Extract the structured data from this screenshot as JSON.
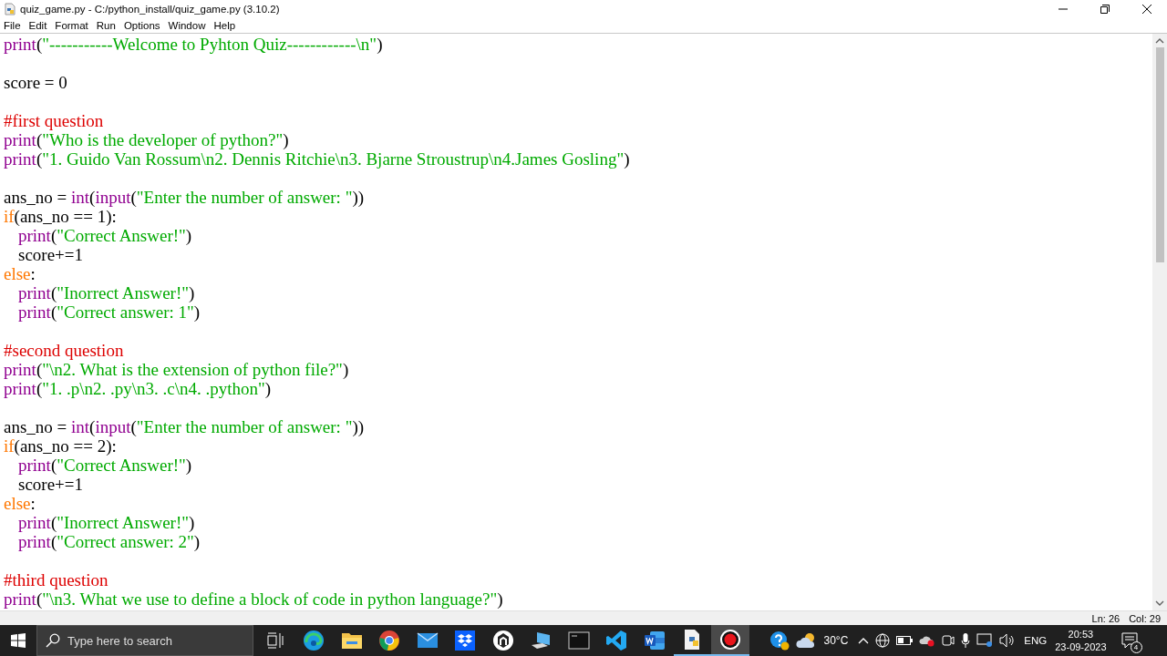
{
  "window": {
    "title": "quiz_game.py - C:/python_install/quiz_game.py (3.10.2)"
  },
  "menu": [
    "File",
    "Edit",
    "Format",
    "Run",
    "Options",
    "Window",
    "Help"
  ],
  "editor": {
    "lines": [
      {
        "kind": "code",
        "tokens": [
          {
            "kind": "builtin",
            "text": "print"
          },
          {
            "kind": "plain",
            "text": "("
          },
          {
            "kind": "string",
            "text": "\"-----------Welcome to Pyhton Quiz------------\\n\""
          },
          {
            "kind": "plain",
            "text": ")"
          }
        ]
      },
      {
        "kind": "blank"
      },
      {
        "kind": "code",
        "tokens": [
          {
            "kind": "plain",
            "text": "score = 0"
          }
        ]
      },
      {
        "kind": "blank"
      },
      {
        "kind": "code",
        "tokens": [
          {
            "kind": "comment",
            "text": "#first question"
          }
        ]
      },
      {
        "kind": "code",
        "tokens": [
          {
            "kind": "builtin",
            "text": "print"
          },
          {
            "kind": "plain",
            "text": "("
          },
          {
            "kind": "string",
            "text": "\"Who is the developer of python?\""
          },
          {
            "kind": "plain",
            "text": ")"
          }
        ]
      },
      {
        "kind": "code",
        "tokens": [
          {
            "kind": "builtin",
            "text": "print"
          },
          {
            "kind": "plain",
            "text": "("
          },
          {
            "kind": "string",
            "text": "\"1. Guido Van Rossum\\n2. Dennis Ritchie\\n3. Bjarne Stroustrup\\n4.James Gosling\""
          },
          {
            "kind": "plain",
            "text": ")"
          }
        ]
      },
      {
        "kind": "blank"
      },
      {
        "kind": "code",
        "tokens": [
          {
            "kind": "plain",
            "text": "ans_no = "
          },
          {
            "kind": "builtin",
            "text": "int"
          },
          {
            "kind": "plain",
            "text": "("
          },
          {
            "kind": "builtin",
            "text": "input"
          },
          {
            "kind": "plain",
            "text": "("
          },
          {
            "kind": "string",
            "text": "\"Enter the number of answer: \""
          },
          {
            "kind": "plain",
            "text": "))"
          }
        ]
      },
      {
        "kind": "code",
        "tokens": [
          {
            "kind": "keyword",
            "text": "if"
          },
          {
            "kind": "plain",
            "text": "(ans_no == 1):"
          }
        ]
      },
      {
        "kind": "indented",
        "tokens": [
          {
            "kind": "builtin",
            "text": "print"
          },
          {
            "kind": "plain",
            "text": "("
          },
          {
            "kind": "string",
            "text": "\"Correct Answer!\""
          },
          {
            "kind": "plain",
            "text": ")"
          }
        ]
      },
      {
        "kind": "indented",
        "tokens": [
          {
            "kind": "plain",
            "text": "score+=1"
          }
        ]
      },
      {
        "kind": "code",
        "tokens": [
          {
            "kind": "keyword",
            "text": "else"
          },
          {
            "kind": "plain",
            "text": ":"
          }
        ]
      },
      {
        "kind": "indented",
        "tokens": [
          {
            "kind": "builtin",
            "text": "print"
          },
          {
            "kind": "plain",
            "text": "("
          },
          {
            "kind": "string",
            "text": "\"Inorrect Answer!\""
          },
          {
            "kind": "plain",
            "text": ")"
          }
        ]
      },
      {
        "kind": "indented",
        "tokens": [
          {
            "kind": "builtin",
            "text": "print"
          },
          {
            "kind": "plain",
            "text": "("
          },
          {
            "kind": "string",
            "text": "\"Correct answer: 1\""
          },
          {
            "kind": "plain",
            "text": ")"
          }
        ]
      },
      {
        "kind": "blank"
      },
      {
        "kind": "code",
        "tokens": [
          {
            "kind": "comment",
            "text": "#second question"
          }
        ]
      },
      {
        "kind": "code",
        "tokens": [
          {
            "kind": "builtin",
            "text": "print"
          },
          {
            "kind": "plain",
            "text": "("
          },
          {
            "kind": "string",
            "text": "\"\\n2. What is the extension of python file?\""
          },
          {
            "kind": "plain",
            "text": ")"
          }
        ]
      },
      {
        "kind": "code",
        "tokens": [
          {
            "kind": "builtin",
            "text": "print"
          },
          {
            "kind": "plain",
            "text": "("
          },
          {
            "kind": "string",
            "text": "\"1. .p\\n2. .py\\n3. .c\\n4. .python\""
          },
          {
            "kind": "plain",
            "text": ")"
          }
        ]
      },
      {
        "kind": "blank"
      },
      {
        "kind": "code",
        "tokens": [
          {
            "kind": "plain",
            "text": "ans_no = "
          },
          {
            "kind": "builtin",
            "text": "int"
          },
          {
            "kind": "plain",
            "text": "("
          },
          {
            "kind": "builtin",
            "text": "input"
          },
          {
            "kind": "plain",
            "text": "("
          },
          {
            "kind": "string",
            "text": "\"Enter the number of answer: \""
          },
          {
            "kind": "plain",
            "text": "))"
          }
        ]
      },
      {
        "kind": "code",
        "tokens": [
          {
            "kind": "keyword",
            "text": "if"
          },
          {
            "kind": "plain",
            "text": "(ans_no == 2):"
          }
        ]
      },
      {
        "kind": "indented",
        "tokens": [
          {
            "kind": "builtin",
            "text": "print"
          },
          {
            "kind": "plain",
            "text": "("
          },
          {
            "kind": "string",
            "text": "\"Correct Answer!\""
          },
          {
            "kind": "plain",
            "text": ")"
          }
        ]
      },
      {
        "kind": "indented",
        "tokens": [
          {
            "kind": "plain",
            "text": "score+=1"
          }
        ]
      },
      {
        "kind": "code",
        "tokens": [
          {
            "kind": "keyword",
            "text": "else"
          },
          {
            "kind": "plain",
            "text": ":"
          }
        ]
      },
      {
        "kind": "indented",
        "tokens": [
          {
            "kind": "builtin",
            "text": "print"
          },
          {
            "kind": "plain",
            "text": "("
          },
          {
            "kind": "string",
            "text": "\"Inorrect Answer!\""
          },
          {
            "kind": "plain",
            "text": ")"
          }
        ]
      },
      {
        "kind": "indented",
        "tokens": [
          {
            "kind": "builtin",
            "text": "print"
          },
          {
            "kind": "plain",
            "text": "("
          },
          {
            "kind": "string",
            "text": "\"Correct answer: 2\""
          },
          {
            "kind": "plain",
            "text": ")"
          }
        ]
      },
      {
        "kind": "blank"
      },
      {
        "kind": "code",
        "tokens": [
          {
            "kind": "comment",
            "text": "#third question"
          }
        ]
      },
      {
        "kind": "code",
        "tokens": [
          {
            "kind": "builtin",
            "text": "print"
          },
          {
            "kind": "plain",
            "text": "("
          },
          {
            "kind": "string",
            "text": "\"\\n3. What we use to define a block of code in python language?\""
          },
          {
            "kind": "plain",
            "text": ")"
          }
        ]
      }
    ]
  },
  "status_bar": {
    "line": "Ln: 26",
    "column": "Col: 29"
  },
  "taskbar": {
    "search": {
      "placeholder": "Type here to search"
    },
    "apps": [
      {
        "kind": "taskview",
        "running": false,
        "selected": false
      },
      {
        "kind": "edge",
        "running": false,
        "selected": false
      },
      {
        "kind": "folder",
        "running": false,
        "selected": false
      },
      {
        "kind": "chrome",
        "running": false,
        "selected": false
      },
      {
        "kind": "mail",
        "running": false,
        "selected": false
      },
      {
        "kind": "dropbox",
        "running": false,
        "selected": false
      },
      {
        "kind": "hexagon",
        "running": false,
        "selected": false
      },
      {
        "kind": "computer",
        "running": false,
        "selected": false
      },
      {
        "kind": "terminal",
        "running": false,
        "selected": false
      },
      {
        "kind": "vscode",
        "running": false,
        "selected": false
      },
      {
        "kind": "word",
        "running": false,
        "selected": false
      },
      {
        "kind": "python",
        "running": true,
        "selected": false
      },
      {
        "kind": "record",
        "running": true,
        "selected": true
      }
    ],
    "weather": "30°C",
    "language": "ENG",
    "time": "20:53",
    "date": "23-09-2023",
    "notifications": "4"
  }
}
